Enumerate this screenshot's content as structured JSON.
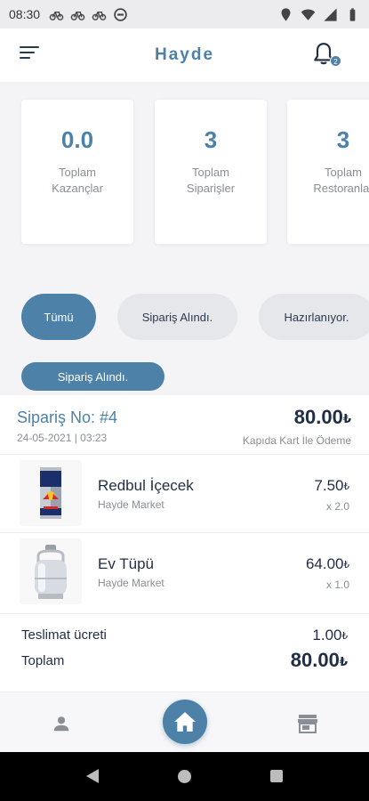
{
  "status_bar": {
    "time": "08:30",
    "left_icons": [
      "bike-icon",
      "bike-icon",
      "bike-icon",
      "dnd-icon"
    ],
    "right_icons": [
      "location-icon",
      "wifi-icon",
      "signal-icon",
      "battery-icon"
    ]
  },
  "header": {
    "title": "Hayde",
    "notification_count": "2"
  },
  "stats": [
    {
      "value": "0.0",
      "label_line1": "Toplam",
      "label_line2": "Kazançlar"
    },
    {
      "value": "3",
      "label_line1": "Toplam",
      "label_line2": "Siparişler"
    },
    {
      "value": "3",
      "label_line1": "Toplam",
      "label_line2": "Restoranlar"
    }
  ],
  "filters": [
    {
      "label": "Tümü",
      "active": true
    },
    {
      "label": "Sipariş Alındı.",
      "active": false
    },
    {
      "label": "Hazırlanıyor.",
      "active": false
    }
  ],
  "order": {
    "status": "Sipariş Alındı.",
    "number": "Sipariş No: #4",
    "date": "24-05-2021 | 03:23",
    "total": "80.00",
    "currency": "₺",
    "payment": "Kapıda Kart İle Ödeme",
    "items": [
      {
        "name": "Redbul İçecek",
        "store": "Hayde Market",
        "price": "7.50",
        "qty": "x 2.0",
        "icon": "energy-drink-can"
      },
      {
        "name": "Ev Tüpü",
        "store": "Hayde Market",
        "price": "64.00",
        "qty": "x 1.0",
        "icon": "gas-cylinder"
      }
    ],
    "delivery_label": "Teslimat ücreti",
    "delivery_value": "1.00",
    "total_label": "Toplam",
    "total_value": "80.00"
  },
  "bottom_nav": [
    "profile-icon",
    "home-icon",
    "store-icon"
  ],
  "colors": {
    "accent": "#4d81a8",
    "text_dark": "#1f2d45",
    "muted": "#8a8f96"
  }
}
